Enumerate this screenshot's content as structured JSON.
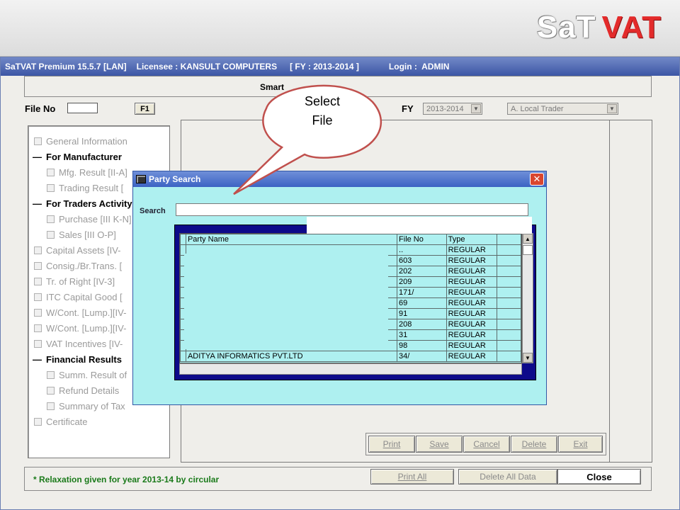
{
  "header": {
    "logo_part1": "SaT",
    "logo_part2": "VAT"
  },
  "titlebar": {
    "product": "SaTVAT Premium 15.5.7 [LAN]",
    "licensee": "Licensee : KANSULT COMPUTERS",
    "fy": "[ FY : 2013-2014 ]",
    "login": "Login :  ADMIN"
  },
  "smart_bar": {
    "title": "Smart"
  },
  "form": {
    "file_no_label": "File No",
    "file_no_value": "",
    "f1_button": "F1",
    "fy_label": "FY",
    "fy_value": "2013-2014",
    "trader_value": "A. Local Trader"
  },
  "tree": {
    "items": [
      {
        "label": "General Information",
        "kind": "check"
      },
      {
        "label": "For Manufacturer",
        "kind": "head"
      },
      {
        "label": "Mfg. Result [II-A]",
        "kind": "check"
      },
      {
        "label": "Trading Result [",
        "kind": "check"
      },
      {
        "label": "For Traders Activity",
        "kind": "head"
      },
      {
        "label": "Purchase [III K-N]",
        "kind": "check"
      },
      {
        "label": "Sales [III O-P]",
        "kind": "check"
      },
      {
        "label": "Capital Assets [IV-",
        "kind": "check"
      },
      {
        "label": "Consig./Br.Trans. [",
        "kind": "check"
      },
      {
        "label": "Tr. of Right [IV-3]",
        "kind": "check"
      },
      {
        "label": "ITC Capital Good [",
        "kind": "check"
      },
      {
        "label": "W/Cont. [Lump.][IV-",
        "kind": "check"
      },
      {
        "label": "W/Cont. [Lump.][IV-",
        "kind": "check"
      },
      {
        "label": "VAT Incentives [IV-",
        "kind": "check"
      },
      {
        "label": "Financial Results",
        "kind": "head"
      },
      {
        "label": "Summ. Result of",
        "kind": "check"
      },
      {
        "label": "Refund Details",
        "kind": "check"
      },
      {
        "label": "Summary of Tax",
        "kind": "check"
      },
      {
        "label": "Certificate",
        "kind": "check"
      }
    ]
  },
  "actions": {
    "print": "Print",
    "save": "Save",
    "cancel": "Cancel",
    "delete": "Delete",
    "exit": "Exit"
  },
  "footer": {
    "note": "* Relaxation given for year 2013-14 by circular",
    "print_all": "Print All",
    "delete_all": "Delete All Data",
    "close": "Close"
  },
  "dialog": {
    "title": "Party Search",
    "close_glyph": "✕",
    "search_label": "Search",
    "search_value": "",
    "columns": [
      "Party Name",
      "File No",
      "Type"
    ],
    "rows": [
      {
        "name": "",
        "file_no": "..",
        "type": "REGULAR"
      },
      {
        "name": ".",
        "file_no": "603",
        "type": "REGULAR"
      },
      {
        "name": "",
        "file_no": "202",
        "type": "REGULAR"
      },
      {
        "name": "",
        "file_no": "209",
        "type": "REGULAR"
      },
      {
        "name": "",
        "file_no": "171/",
        "type": "REGULAR"
      },
      {
        "name": "",
        "file_no": "69",
        "type": "REGULAR"
      },
      {
        "name": "",
        "file_no": "91",
        "type": "REGULAR"
      },
      {
        "name": "",
        "file_no": "208",
        "type": "REGULAR"
      },
      {
        "name": "",
        "file_no": "31",
        "type": "REGULAR"
      },
      {
        "name": "",
        "file_no": "98",
        "type": "REGULAR"
      },
      {
        "name": "ADITYA INFORMATICS PVT.LTD",
        "file_no": "34/",
        "type": "REGULAR"
      }
    ]
  },
  "callout": {
    "line1": "Select",
    "line2": "File"
  },
  "colors": {
    "titlebar": "#3c56a5",
    "dialog_bg": "#aef0f0",
    "list_frame": "#0d0a8a",
    "footer_note": "#1a7a1a",
    "logo_red": "#e32b2b",
    "callout_stroke": "#c0504d"
  }
}
